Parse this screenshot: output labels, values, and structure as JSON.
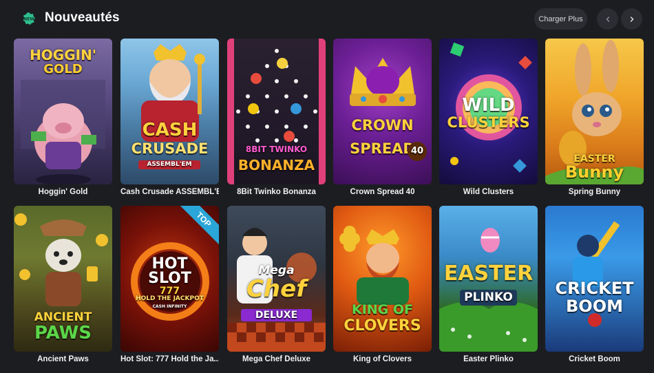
{
  "header": {
    "badge_text": "NEW",
    "title": "Nouveautés",
    "load_more_label": "Charger Plus",
    "prev_icon": "chevron-left-icon",
    "next_icon": "chevron-right-icon"
  },
  "games": [
    {
      "name": "Hoggin' Gold",
      "logo": [
        "HOGGIN'",
        "GOLD"
      ]
    },
    {
      "name": "Cash Crusade ASSEMBL'E...",
      "logo": [
        "CASH",
        "CRUSADE",
        "ASSEMBL'EM"
      ]
    },
    {
      "name": "8Bit Twinko Bonanza",
      "logo": [
        "8BIT TWINKO",
        "BONANZA"
      ]
    },
    {
      "name": "Crown Spread 40",
      "logo": [
        "CROWN",
        "SPREAD",
        "40"
      ]
    },
    {
      "name": "Wild Clusters",
      "logo": [
        "WILD",
        "CLUSTERS"
      ]
    },
    {
      "name": "Spring Bunny",
      "logo": [
        "EASTER",
        "Bunny"
      ]
    },
    {
      "name": "Ancient Paws",
      "logo": [
        "ANCIENT",
        "PAWS"
      ]
    },
    {
      "name": "Hot Slot: 777 Hold the Ja...",
      "logo": [
        "HOT",
        "SLOT",
        "777",
        "HOLD THE JACKPOT",
        "CASH INFINITY"
      ],
      "ribbon": "TOP"
    },
    {
      "name": "Mega Chef Deluxe",
      "logo": [
        "Mega",
        "Chef",
        "DELUXE"
      ]
    },
    {
      "name": "King of Clovers",
      "logo": [
        "KING OF",
        "CLOVERS"
      ]
    },
    {
      "name": "Easter Plinko",
      "logo": [
        "EASTER",
        "PLINKO"
      ]
    },
    {
      "name": "Cricket Boom",
      "logo": [
        "CRICKET",
        "BOOM"
      ]
    }
  ]
}
